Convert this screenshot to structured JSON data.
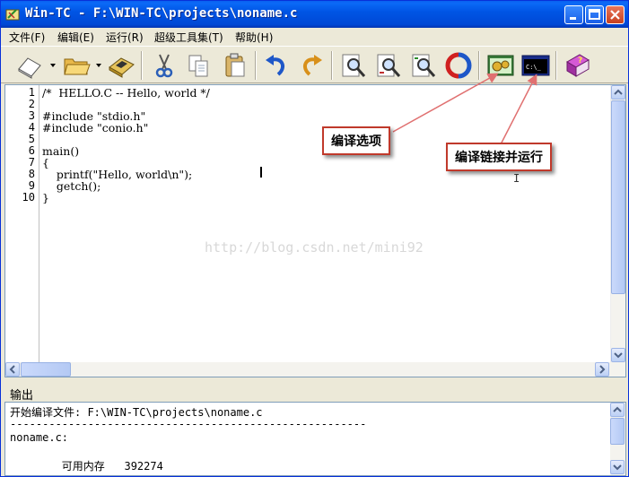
{
  "window": {
    "title": "Win-TC - F:\\WIN-TC\\projects\\noname.c"
  },
  "menu": [
    {
      "label": "文件(F)"
    },
    {
      "label": "编辑(E)"
    },
    {
      "label": "运行(R)"
    },
    {
      "label": "超级工具集(T)"
    },
    {
      "label": "帮助(H)"
    }
  ],
  "toolbar": {
    "buttons": [
      {
        "name": "new-file",
        "icon": "new-file-icon"
      },
      {
        "name": "open-file",
        "icon": "open-folder-icon"
      },
      {
        "name": "save-file",
        "icon": "save-disk-icon"
      },
      {
        "name": "cut",
        "icon": "scissors-icon"
      },
      {
        "name": "copy",
        "icon": "copy-icon"
      },
      {
        "name": "paste",
        "icon": "paste-icon"
      },
      {
        "name": "undo",
        "icon": "undo-icon"
      },
      {
        "name": "redo",
        "icon": "redo-icon"
      },
      {
        "name": "find",
        "icon": "find-icon"
      },
      {
        "name": "find-next",
        "icon": "find-next-icon"
      },
      {
        "name": "replace",
        "icon": "replace-icon"
      },
      {
        "name": "refresh",
        "icon": "refresh-icon"
      },
      {
        "name": "compile-options",
        "icon": "compile-options-icon"
      },
      {
        "name": "compile-run",
        "icon": "console-icon"
      },
      {
        "name": "help-book",
        "icon": "help-book-icon"
      }
    ],
    "console_icon_text": "C:\\_"
  },
  "editor": {
    "lines": [
      {
        "num": "1",
        "text": "/*  HELLO.C -- Hello, world */"
      },
      {
        "num": "2",
        "text": ""
      },
      {
        "num": "3",
        "text": "#include \"stdio.h\""
      },
      {
        "num": "4",
        "text": "#include \"conio.h\""
      },
      {
        "num": "5",
        "text": ""
      },
      {
        "num": "6",
        "text": "main()"
      },
      {
        "num": "7",
        "text": "{"
      },
      {
        "num": "8",
        "text": "    printf(\"Hello, world\\n\");"
      },
      {
        "num": "9",
        "text": "    getch();"
      },
      {
        "num": "10",
        "text": "}"
      }
    ],
    "watermark": "http://blog.csdn.net/mini92"
  },
  "callouts": {
    "compile_options": "编译选项",
    "compile_link_run": "编译链接并运行"
  },
  "output": {
    "label": "输出",
    "lines": [
      "开始编译文件: F:\\WIN-TC\\projects\\noname.c",
      "-------------------------------------------------------",
      "noname.c:",
      "",
      "        可用内存   392274"
    ]
  },
  "colors": {
    "titlebar": "#0055e5",
    "callout_border": "#c0392b",
    "arrow": "#e07070"
  }
}
